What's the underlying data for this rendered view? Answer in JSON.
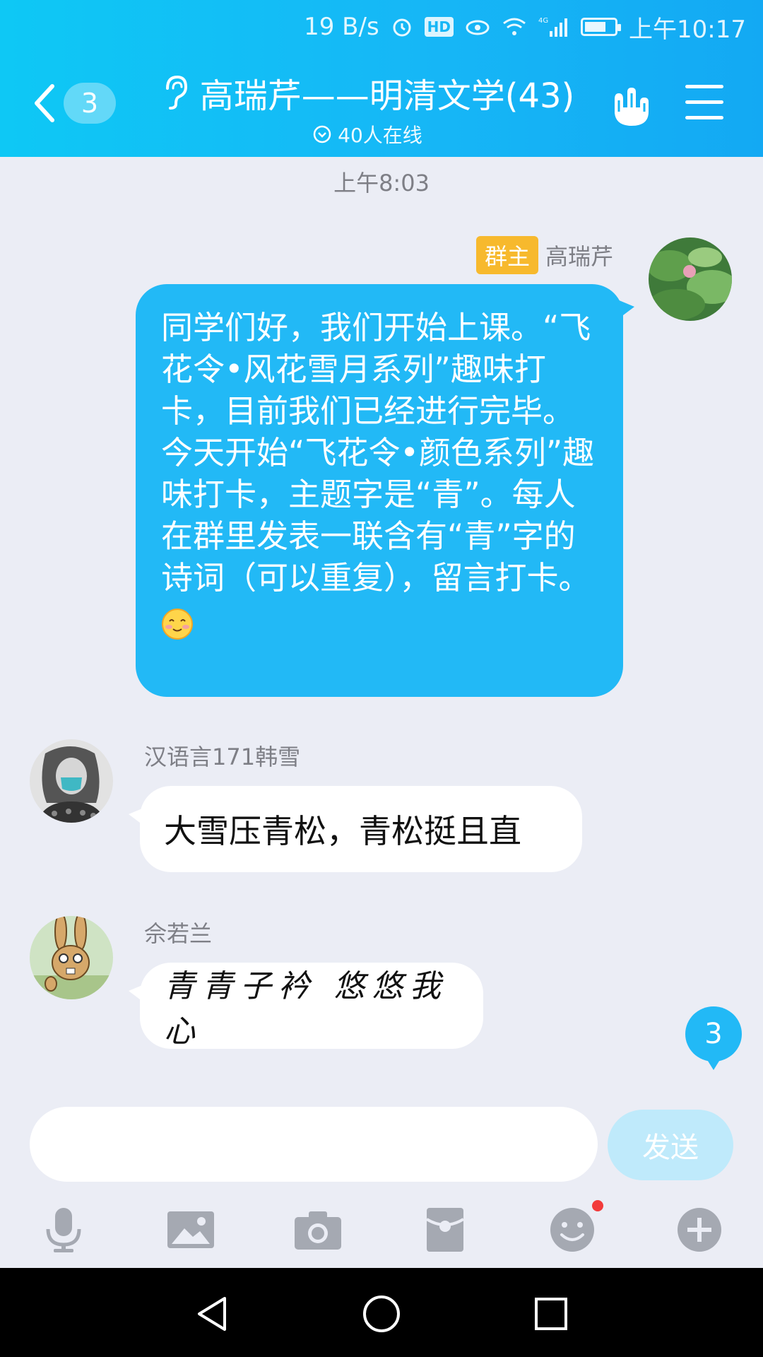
{
  "statusbar": {
    "speed": "19 B/s",
    "hd": "HD",
    "network": "4G",
    "time": "上午10:17"
  },
  "header": {
    "back_count": "3",
    "title": "高瑞芹——明清文学(43)",
    "online": "40人在线"
  },
  "chat": {
    "divider_time": "上午8:03",
    "messages": [
      {
        "sender": "高瑞芹",
        "role_badge": "群主",
        "self": true,
        "text": "同学们好，我们开始上课。“飞花令•风花雪月系列”趣味打卡，目前我们已经进行完毕。今天开始“飞花令•颜色系列”趣味打卡，主题字是“青”。每人在群里发表一联含有“青”字的诗词（可以重复），留言打卡。"
      },
      {
        "sender": "汉语言171韩雪",
        "self": false,
        "text": "大雪压青松，青松挺且直"
      },
      {
        "sender": "佘若兰",
        "self": false,
        "text": "青青子衿 悠悠我心"
      }
    ],
    "unread_count": "3"
  },
  "composer": {
    "placeholder": "",
    "send_label": "发送"
  },
  "colors": {
    "accent": "#22b9f6",
    "badge": "#f7b92d"
  },
  "icons": [
    "back-icon",
    "ear-icon",
    "hand-gesture-icon",
    "menu-icon",
    "microphone-icon",
    "image-icon",
    "camera-icon",
    "red-packet-icon",
    "emoji-icon",
    "plus-icon",
    "nav-back-icon",
    "nav-home-icon",
    "nav-recents-icon"
  ]
}
